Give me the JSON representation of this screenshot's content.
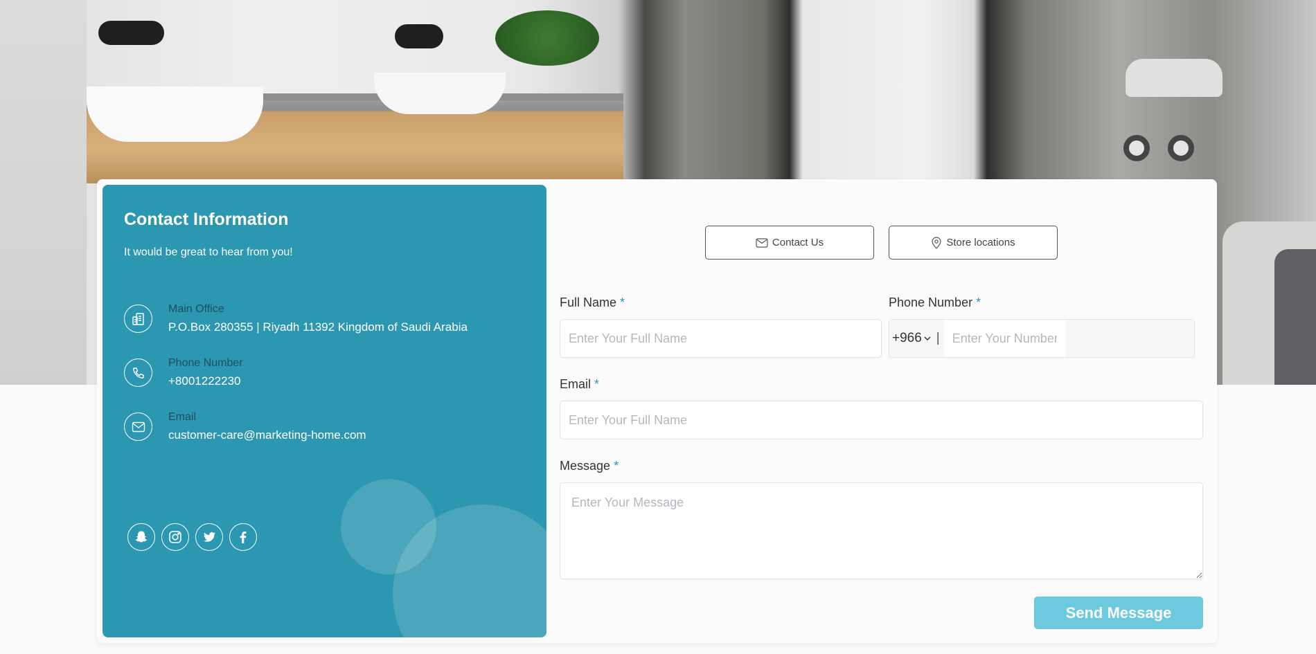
{
  "contact_info": {
    "title": "Contact Information",
    "subtitle": "It would be great to hear from you!",
    "items": [
      {
        "label": "Main Office",
        "value": "P.O.Box 280355 | Riyadh 11392 Kingdom of Saudi Arabia",
        "icon": "office-icon"
      },
      {
        "label": "Phone Number",
        "value": "+8001222230",
        "icon": "phone-icon"
      },
      {
        "label": "Email",
        "value": "customer-care@marketing-home.com",
        "icon": "mail-icon"
      }
    ],
    "socials": [
      "snapchat-icon",
      "instagram-icon",
      "twitter-icon",
      "facebook-icon"
    ]
  },
  "tabs": {
    "contact_us": "Contact Us",
    "store_locations": "Store locations"
  },
  "form": {
    "full_name": {
      "label": "Full Name",
      "required_mark": "*",
      "placeholder": "Enter Your Full Name",
      "value": ""
    },
    "phone": {
      "label": "Phone Number",
      "required_mark": "*",
      "country_code": "+966",
      "separator": "|",
      "placeholder": "Enter Your Number",
      "value": ""
    },
    "email": {
      "label": "Email",
      "required_mark": "*",
      "placeholder": "Enter Your Full Name",
      "value": ""
    },
    "message": {
      "label": "Message",
      "required_mark": "*",
      "placeholder": "Enter Your Message",
      "value": ""
    },
    "submit_label": "Send Message"
  },
  "colors": {
    "accent": "#2c97b0",
    "button": "#6cc9de"
  }
}
